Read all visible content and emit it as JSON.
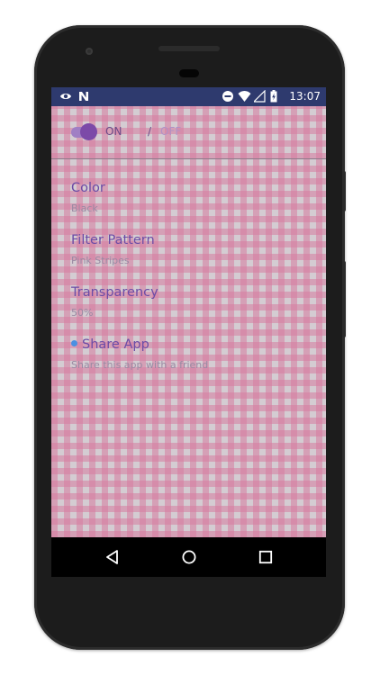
{
  "status_bar": {
    "time": "13:07",
    "left_icons": [
      "eye-icon",
      "n-icon"
    ],
    "right_icons": [
      "do-not-disturb-icon",
      "wifi-icon",
      "signal-icon",
      "battery-icon"
    ]
  },
  "toggle": {
    "on_label": "ON",
    "separator": "/",
    "off_label": "OFF",
    "state": "on"
  },
  "preferences": [
    {
      "title": "Color",
      "summary": "Black"
    },
    {
      "title": "Filter Pattern",
      "summary": "Pink Stripes"
    },
    {
      "title": "Transparency",
      "summary": "50%"
    },
    {
      "title": "Share App",
      "summary": "Share this app with a friend"
    }
  ],
  "nav_bar": [
    "back-icon",
    "home-icon",
    "recents-icon"
  ],
  "colors": {
    "status_bar": "#2e3a6e",
    "accent": "#6b4ca6",
    "pattern": "#d67ba0"
  }
}
